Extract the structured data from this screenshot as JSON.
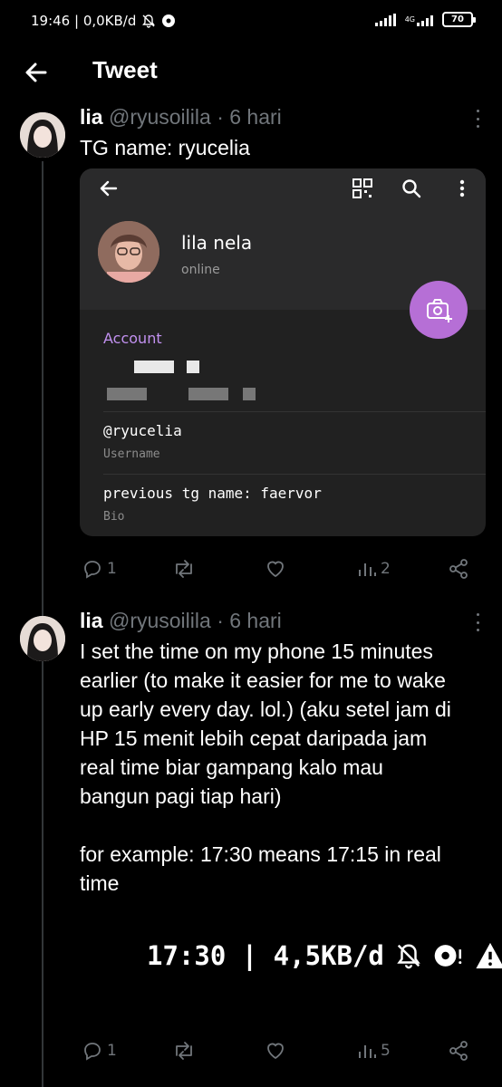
{
  "status_bar": {
    "time_info": "19:46 | 0,0KB/d",
    "network": "4G",
    "battery": "70"
  },
  "header": {
    "title": "Tweet"
  },
  "tweets": [
    {
      "name": "lia",
      "handle": "@ryusoilila",
      "time": "· 6 hari",
      "text": "TG name: ryucelia",
      "replies": "1",
      "retweets": "",
      "likes": "",
      "views": "2"
    },
    {
      "name": "lia",
      "handle": "@ryusoilila",
      "time": "· 6 hari",
      "text": "I set the time on my phone 15 minutes\nearlier (to make it easier for me to wake\nup early every day. lol.) (aku setel jam di\nHP 15 menit lebih cepat daripada jam\nreal time biar gampang kalo mau\nbangun pagi tiap hari)\n\nfor example: 17:30 means 17:15 in real\ntime",
      "replies": "1",
      "retweets": "",
      "likes": "",
      "views": "5"
    }
  ],
  "telegram_card": {
    "profile_name": "lila nela",
    "status": "online",
    "section_title": "Account",
    "username_value": "@ryucelia",
    "username_label": "Username",
    "bio_value": "previous tg name: faervor",
    "bio_label": "Bio"
  },
  "screenshot_status": {
    "text": "17:30 | 4,5KB/d"
  },
  "colors": {
    "background": "#000000",
    "accent_purple": "#c291f0",
    "camera_button": "#b66fd6",
    "muted": "#71767b"
  }
}
